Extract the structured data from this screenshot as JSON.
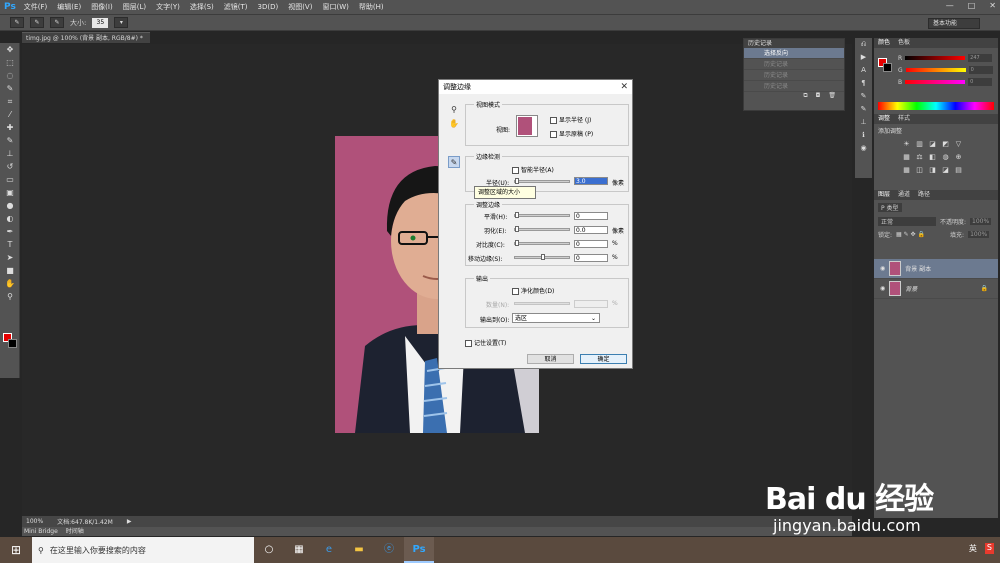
{
  "menubar": {
    "logo": "Ps",
    "items": [
      "文件(F)",
      "编辑(E)",
      "图像(I)",
      "图层(L)",
      "文字(Y)",
      "选择(S)",
      "滤镜(T)",
      "3D(D)",
      "视图(V)",
      "窗口(W)",
      "帮助(H)"
    ]
  },
  "options": {
    "size_label": "大小:",
    "size_value": "35",
    "workspace": "基本功能"
  },
  "document": {
    "tab_title": "timg.jpg @ 100% (背景 副本, RGB/8#) *",
    "zoom": "100%",
    "doc_info": "文档:647.8K/1.42M",
    "bottom_tabs": [
      "Mini Bridge",
      "时间轴"
    ]
  },
  "history": {
    "tabs": [
      "历史记录"
    ],
    "items": [
      "选择反向",
      "历史记录",
      "历史记录",
      "历史记录"
    ]
  },
  "color_panel": {
    "tabs": [
      "颜色",
      "色板"
    ],
    "r": "247",
    "g": "0",
    "b": "0",
    "labels": [
      "R",
      "G",
      "B"
    ]
  },
  "adjust_panel": {
    "tabs": [
      "调整",
      "样式"
    ],
    "subtitle": "添加调整"
  },
  "layers_panel": {
    "tabs": [
      "图层",
      "通道",
      "路径"
    ],
    "kind": "P 类型",
    "mode": "正常",
    "opacity_label": "不透明度:",
    "opacity": "100%",
    "lock_label": "锁定:",
    "fill_label": "填充:",
    "fill": "100%",
    "layers": [
      {
        "name": "背景 副本",
        "active": true
      },
      {
        "name": "背景",
        "active": false
      }
    ]
  },
  "dialog": {
    "title": "调整边缘",
    "view_mode": {
      "legend": "视图模式",
      "view_label": "视图:",
      "show_radius": "显示半径 (J)",
      "show_original": "显示原稿 (P)"
    },
    "edge_detection": {
      "legend": "边缘检测",
      "smart_radius": "智能半径(A)",
      "radius_label": "半径(U):",
      "radius_value": "3.0",
      "radius_unit": "像素"
    },
    "tooltip": "调整区域的大小",
    "adjust_edge": {
      "legend": "调整边缘",
      "smooth_label": "平滑(H):",
      "smooth_value": "0",
      "feather_label": "羽化(E):",
      "feather_value": "0.0",
      "feather_unit": "像素",
      "contrast_label": "对比度(C):",
      "contrast_value": "0",
      "contrast_unit": "%",
      "shift_label": "移动边缘(S):",
      "shift_value": "0",
      "shift_unit": "%"
    },
    "output": {
      "legend": "输出",
      "decontaminate": "净化颜色(D)",
      "amount_label": "数量(N):",
      "amount_unit": "%",
      "output_to_label": "输出到(O):",
      "output_to_value": "选区"
    },
    "remember": "记住设置(T)",
    "cancel": "取消",
    "ok": "确定"
  },
  "taskbar": {
    "search_placeholder": "在这里输入你要搜索的内容",
    "ps_label": "Ps",
    "tray_lang": "英",
    "tray_ime": "S"
  },
  "watermark": {
    "brand": "Bai du 经验",
    "url": "jingyan.baidu.com"
  },
  "colors": {
    "accent": "#31a8ff",
    "selection": "#6c7a90",
    "photo_bg": "#b0517a",
    "fg": "#e50000"
  }
}
